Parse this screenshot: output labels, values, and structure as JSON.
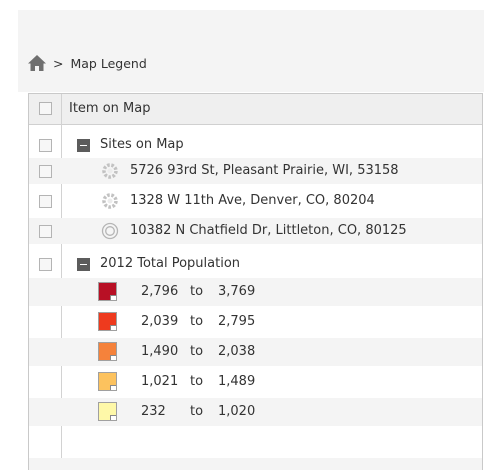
{
  "breadcrumb": {
    "separator": ">",
    "current": "Map Legend"
  },
  "table": {
    "header": "Item on Map"
  },
  "groups": [
    {
      "label": "Sites on Map",
      "items": [
        {
          "label": "5726 93rd St, Pleasant Prairie, WI, 53158",
          "icon": "gear-marker-icon"
        },
        {
          "label": "1328 W 11th Ave, Denver, CO, 80204",
          "icon": "gear-marker-icon"
        },
        {
          "label": "10382 N Chatfield Dr, Littleton, CO, 80125",
          "icon": "ring-marker-icon"
        }
      ]
    },
    {
      "label": "2012 Total Population",
      "classes": [
        {
          "from": "2,796",
          "to_word": "to",
          "to": "3,769",
          "color": "#b81025"
        },
        {
          "from": "2,039",
          "to_word": "to",
          "to": "2,795",
          "color": "#ee3a1e"
        },
        {
          "from": "1,490",
          "to_word": "to",
          "to": "2,038",
          "color": "#f5823b"
        },
        {
          "from": "1,021",
          "to_word": "to",
          "to": "1,489",
          "color": "#fcc25e"
        },
        {
          "from": "232",
          "to_word": "to",
          "to": "1,020",
          "color": "#fef8a8"
        }
      ]
    }
  ]
}
